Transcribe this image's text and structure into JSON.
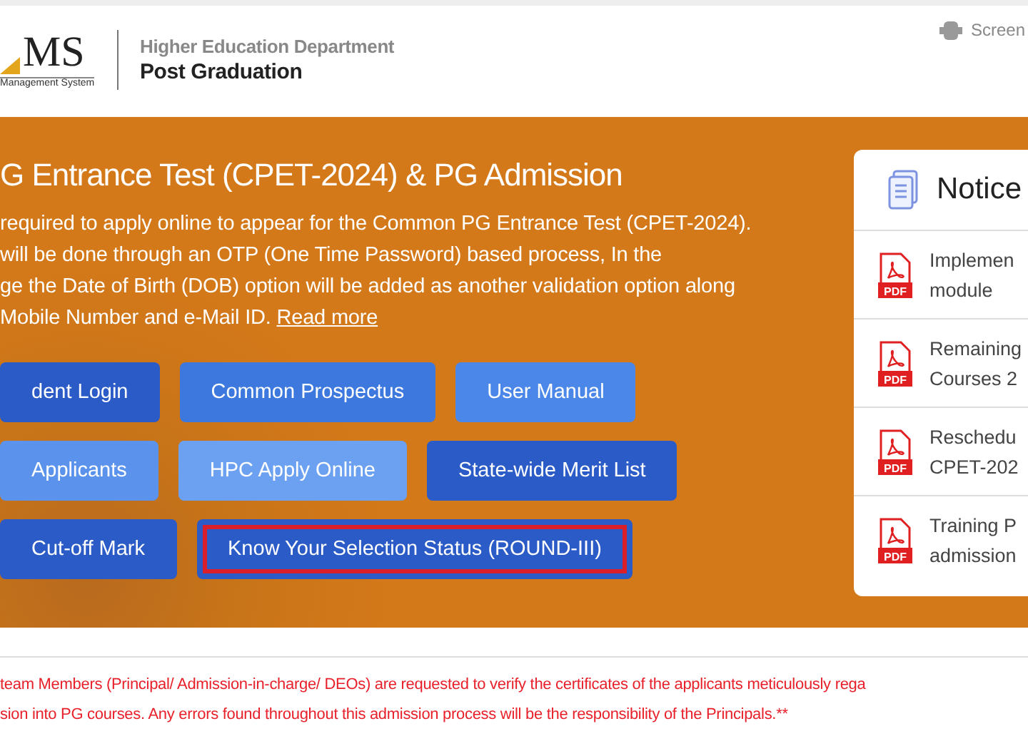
{
  "header": {
    "logo_text": "MS",
    "logo_subtitle": "Management System",
    "department": "Higher Education Department",
    "section": "Post Graduation",
    "screen_reader": "Screen"
  },
  "banner": {
    "title": "G Entrance Test (CPET-2024) & PG Admission",
    "paragraph_lines": [
      "required to apply online to appear for the Common PG Entrance Test (CPET-2024).",
      "will be done through an OTP (One Time Password) based process, In the",
      "ge the Date of Birth (DOB) option will be added as another validation option along",
      "Mobile Number and e-Mail ID."
    ],
    "read_more": "Read more",
    "button_rows": [
      [
        {
          "label": "dent Login",
          "color": "#2b5bc6",
          "highlighted": false
        },
        {
          "label": "Common Prospectus",
          "color": "#3d78de",
          "highlighted": false
        },
        {
          "label": "User Manual",
          "color": "#4b87e8",
          "highlighted": false
        }
      ],
      [
        {
          "label": "Applicants",
          "color": "#5b93ec",
          "highlighted": false
        },
        {
          "label": "HPC Apply Online",
          "color": "#6ca0f0",
          "highlighted": false
        },
        {
          "label": "State-wide Merit List",
          "color": "#2b5bc6",
          "highlighted": false
        }
      ],
      [
        {
          "label": "Cut-off Mark",
          "color": "#2b5bc6",
          "highlighted": false
        },
        {
          "label": "Know Your Selection Status (ROUND-III)",
          "color": "#2b5bc6",
          "highlighted": true
        }
      ]
    ]
  },
  "notices": {
    "title": "Notice",
    "items": [
      {
        "icon_text": "PDF",
        "lines": [
          "Implemen",
          "module"
        ]
      },
      {
        "icon_text": "PDF",
        "lines": [
          "Remaining",
          "Courses 2"
        ]
      },
      {
        "icon_text": "PDF",
        "lines": [
          "Reschedu",
          "CPET-202"
        ]
      },
      {
        "icon_text": "PDF",
        "lines": [
          "Training P",
          "admission"
        ]
      }
    ]
  },
  "footer_lines": [
    "team Members (Principal/ Admission-in-charge/ DEOs) are requested to verify the certificates of the applicants meticulously rega",
    "sion into PG courses. Any errors found throughout this admission process will be the responsibility of the Principals.**"
  ]
}
